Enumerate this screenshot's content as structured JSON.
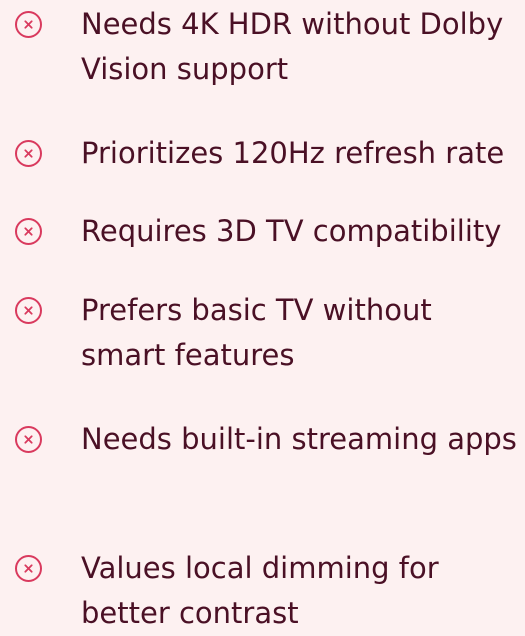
{
  "colors": {
    "background": "#fdf1f1",
    "text": "#4a1025",
    "icon": "#d93a5e"
  },
  "criteria": [
    {
      "icon": "x-circle-icon",
      "text": "Needs 4K HDR without Dolby Vision support"
    },
    {
      "icon": "x-circle-icon",
      "text": "Prioritizes 120Hz refresh rate"
    },
    {
      "icon": "x-circle-icon",
      "text": "Requires 3D TV compatibility"
    },
    {
      "icon": "x-circle-icon",
      "text": "Prefers basic TV without smart features"
    },
    {
      "icon": "x-circle-icon",
      "text": "Needs built-in streaming apps"
    },
    {
      "icon": "x-circle-icon",
      "text": "Values local dimming for better contrast"
    }
  ]
}
